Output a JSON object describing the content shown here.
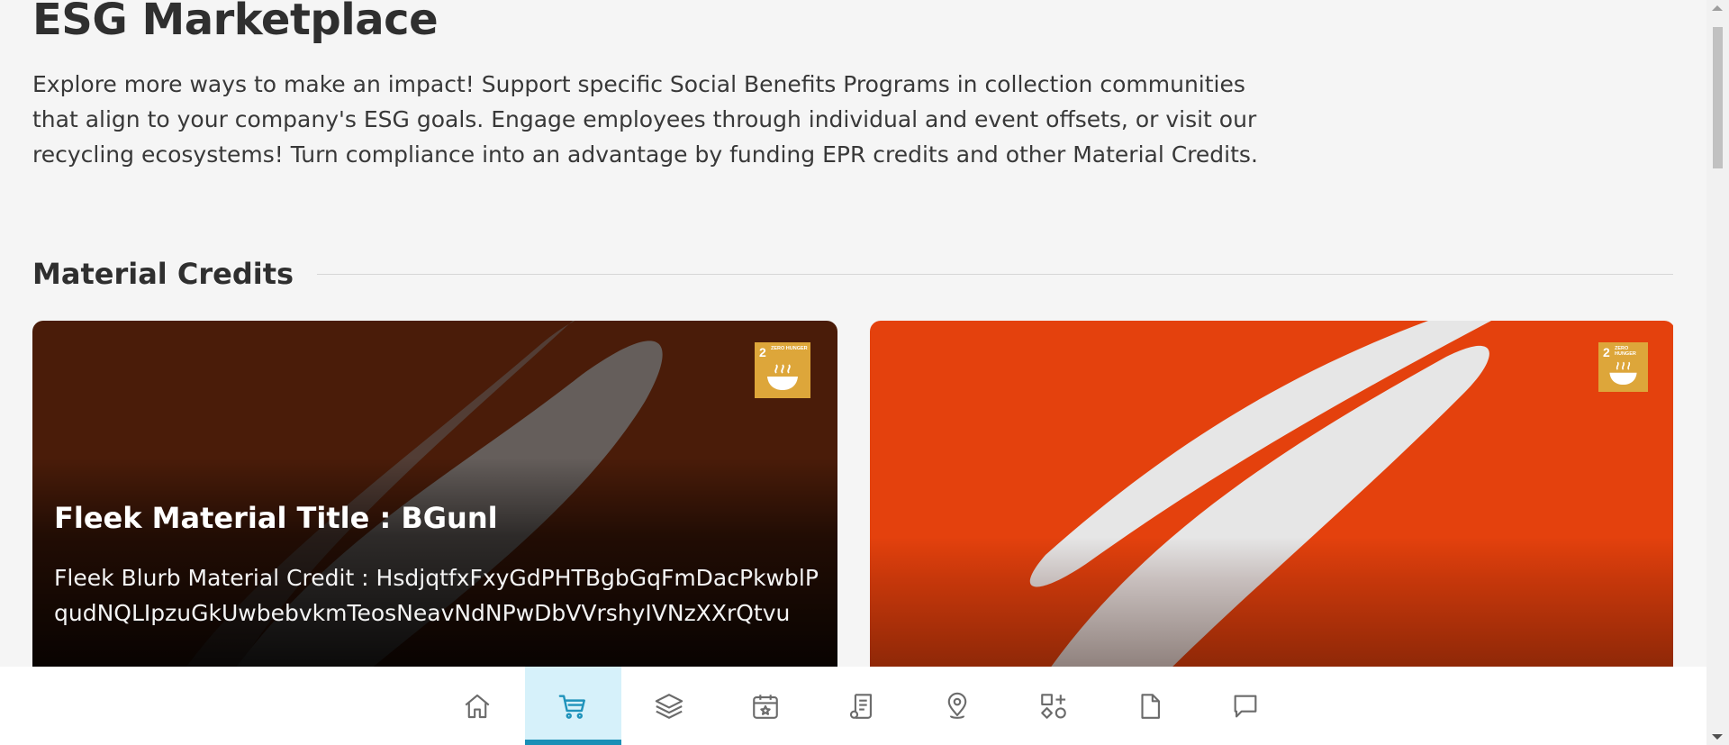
{
  "page": {
    "title": "ESG Marketplace",
    "intro": "Explore more ways to make an impact! Support specific Social Benefits Programs in collection communities that align to your company's ESG goals. Engage employees through individual and event offsets, or visit our recycling ecosystems! Turn compliance into an advantage by funding EPR credits and other Material Credits."
  },
  "section": {
    "title": "Material Credits"
  },
  "cards": [
    {
      "title": "Fleek Material Title : BGunl",
      "blurb": "Fleek Blurb Material Credit : HsdjqtfxFxyGdPHTBgbGqFmDacPkwblPqudNQLIpzuGkUwbebvkmTeosNeavNdNPwDbVVrshyIVNzXXrQtvu",
      "badge_number": "2",
      "badge_text": "ZERO HUNGER",
      "colors": {
        "background": "#4a1c09",
        "swoosh": "#6b6b6b"
      }
    },
    {
      "title": "",
      "blurb": "",
      "badge_number": "2",
      "badge_text": "ZERO HUNGER",
      "colors": {
        "background": "#e4410d",
        "swoosh": "#e6e6e6"
      }
    }
  ],
  "bottom_nav": {
    "active_index": 1,
    "items": [
      {
        "icon": "home-icon"
      },
      {
        "icon": "cart-icon"
      },
      {
        "icon": "layers-icon"
      },
      {
        "icon": "calendar-star-icon"
      },
      {
        "icon": "document-list-icon"
      },
      {
        "icon": "map-pin-icon"
      },
      {
        "icon": "grid-shapes-icon"
      },
      {
        "icon": "file-icon"
      },
      {
        "icon": "chat-icon"
      }
    ]
  },
  "theme": {
    "accent": "#1a8fb6",
    "active_tab_bg": "#d6f1fa",
    "badge": "#dda63a"
  }
}
